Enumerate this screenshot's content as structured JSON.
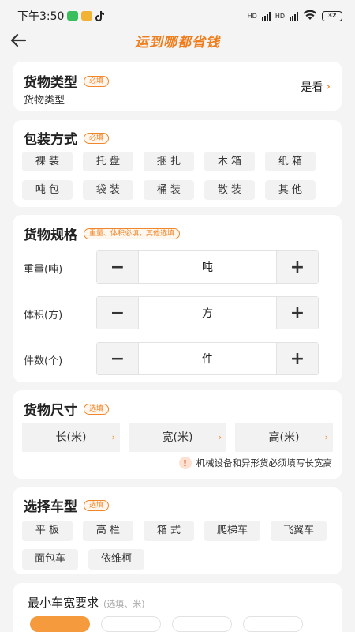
{
  "status": {
    "time": "下午3:50",
    "signal1": "HD",
    "signal2": "HD",
    "battery": "32"
  },
  "nav": {
    "title": "运到哪都省钱"
  },
  "cargo_type": {
    "title": "货物类型",
    "tag": "必填",
    "value": "货物类型",
    "action": "是看",
    "action_arrow": "›"
  },
  "packaging": {
    "title": "包装方式",
    "tag": "必填",
    "options": [
      "裸 装",
      "托 盘",
      "捆 扎",
      "木 箱",
      "纸 箱",
      "吨 包",
      "袋 装",
      "桶 装",
      "散 装",
      "其 他"
    ]
  },
  "specs": {
    "title": "货物规格",
    "tag": "重量、体积必填，其他选填",
    "rows": [
      {
        "label": "重量(吨)",
        "unit": "吨",
        "minus": "−",
        "plus": "+"
      },
      {
        "label": "体积(方)",
        "unit": "方",
        "minus": "−",
        "plus": "+"
      },
      {
        "label": "件数(个)",
        "unit": "件",
        "minus": "−",
        "plus": "+"
      }
    ]
  },
  "dimensions": {
    "title": "货物尺寸",
    "tag": "选填",
    "fields": [
      {
        "label": "长(米)",
        "arrow": "›"
      },
      {
        "label": "宽(米)",
        "arrow": "›"
      },
      {
        "label": "高(米)",
        "arrow": "›"
      }
    ],
    "notice_icon": "!",
    "notice": "机械设备和异形货必须填写长宽高"
  },
  "vehicle": {
    "title": "选择车型",
    "tag": "选填",
    "options": [
      "平 板",
      "高 栏",
      "箱 式",
      "爬梯车",
      "飞翼车",
      "面包车",
      "依维柯"
    ]
  },
  "min_width": {
    "title": "最小车宽要求",
    "hint": "(选填、米)"
  },
  "colors": {
    "accent": "#f07d1c",
    "tag_border": "#f0872c",
    "chip_bg": "#f2f2f2",
    "page_bg": "#f4f4f4"
  }
}
